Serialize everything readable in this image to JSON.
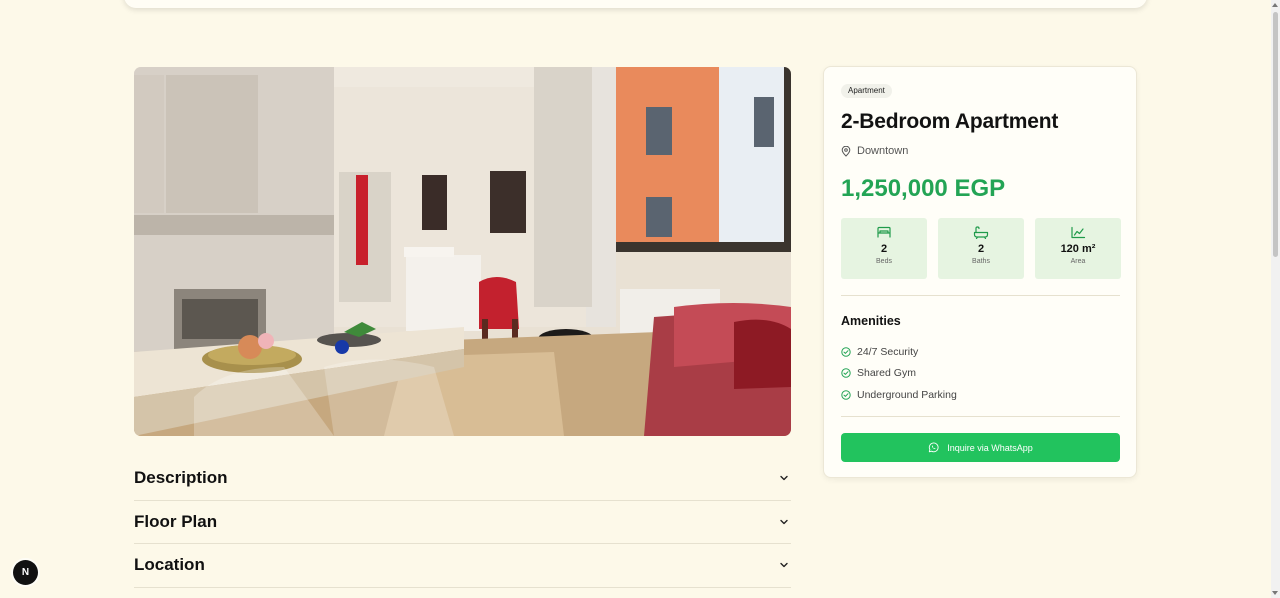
{
  "property": {
    "type_badge": "Apartment",
    "title": "2-Bedroom Apartment",
    "location": "Downtown",
    "price": "1,250,000 EGP",
    "stats": [
      {
        "icon": "bed-icon",
        "value": "2",
        "label": "Beds"
      },
      {
        "icon": "bath-icon",
        "value": "2",
        "label": "Baths"
      },
      {
        "icon": "area-chart-icon",
        "value": "120 m²",
        "label": "Area"
      }
    ],
    "amenities_title": "Amenities",
    "amenities": [
      "24/7 Security",
      "Shared Gym",
      "Underground Parking"
    ],
    "cta_label": "Inquire via WhatsApp"
  },
  "sections": [
    {
      "label": "Description"
    },
    {
      "label": "Floor Plan"
    },
    {
      "label": "Location"
    }
  ],
  "dev_badge": "N",
  "colors": {
    "background": "#fdf9e9",
    "accent_green": "#23a455",
    "whatsapp_green": "#22c35e",
    "stat_bg": "#e6f4e1"
  }
}
